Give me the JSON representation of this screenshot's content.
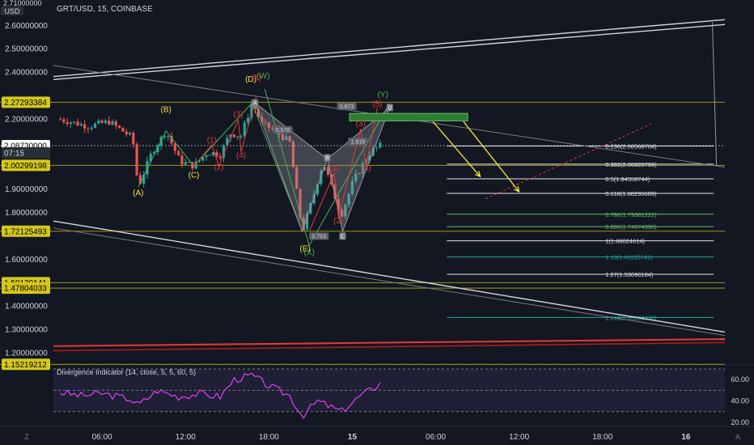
{
  "header": {
    "symbol_line": "GRT/USD, 15, COINBASE"
  },
  "price_axis": {
    "currency": "USD",
    "top_label": "2.71000000",
    "ticks": [
      "2.60000000",
      "2.50000000",
      "2.40000000",
      "2.20000000",
      "1.90000000",
      "1.80000000",
      "1.60000000",
      "1.40000000",
      "1.30000000",
      "1.20000000"
    ],
    "tick_values": [
      2.6,
      2.5,
      2.4,
      2.2,
      1.9,
      1.8,
      1.6,
      1.4,
      1.3,
      1.2
    ],
    "tags": [
      {
        "text": "2.27293384",
        "value": 2.27293384,
        "color": "#d4c81c",
        "tcolor": "#000000"
      },
      {
        "text": "2.08730000",
        "value": 2.0873,
        "color": "#ffffff",
        "tcolor": "#000000"
      },
      {
        "text": "07:15",
        "value": 2.0565,
        "color": "#2a2e39",
        "tcolor": "#d1d4dc"
      },
      {
        "text": "2.00299198",
        "value": 2.00299198,
        "color": "#d4c81c",
        "tcolor": "#000000"
      },
      {
        "text": "1.72125493",
        "value": 1.72125493,
        "color": "#d4c81c",
        "tcolor": "#000000"
      },
      {
        "text": "1.50139141",
        "value": 1.50139141,
        "color": "#d4c81c",
        "tcolor": "#000000"
      },
      {
        "text": "1.47804033",
        "value": 1.47804033,
        "color": "#d4c81c",
        "tcolor": "#000000"
      },
      {
        "text": "1.15219212",
        "value": 1.15219212,
        "color": "#d4c81c",
        "tcolor": "#000000"
      }
    ]
  },
  "time_axis": {
    "ticks": [
      "06:00",
      "12:00",
      "18:00",
      "15",
      "06:00",
      "12:00",
      "18:00",
      "16"
    ],
    "tick_hours": [
      6,
      12,
      18,
      24,
      30,
      36,
      42,
      48
    ]
  },
  "fib_levels": [
    {
      "label": "0.236(2.08568764)",
      "value": 2.08568764,
      "color": "#e0e3eb"
    },
    {
      "label": "0.382(2.00820799)",
      "value": 2.00820799,
      "color": "#e0e3eb"
    },
    {
      "label": "0.5(1.94558744)",
      "value": 1.94558744,
      "color": "#e0e3eb"
    },
    {
      "label": "0.618(1.88296689)",
      "value": 1.88296689,
      "color": "#e0e3eb"
    },
    {
      "label": "0.786(1.79381222)",
      "value": 1.79381222,
      "color": "#66bb6a"
    },
    {
      "label": "0.886(1.74074396)",
      "value": 1.74074396,
      "color": "#66bb6a"
    },
    {
      "label": "1(1.68024614)",
      "value": 1.68024614,
      "color": "#e0e3eb"
    },
    {
      "label": "1.13(1.61125741)",
      "value": 1.61125741,
      "color": "#26a69a"
    },
    {
      "label": "1.27(1.53696184)",
      "value": 1.53696184,
      "color": "#e0e3eb"
    },
    {
      "label": "1.618(1.35228430)",
      "value": 1.3522843,
      "color": "#26a69a"
    }
  ],
  "wave_labels": [
    {
      "text": "(A)",
      "color": "#f5e342",
      "t": 8.6,
      "v": 1.875
    },
    {
      "text": "(B)",
      "color": "#f5e342",
      "t": 10.6,
      "v": 2.23
    },
    {
      "text": "(C)",
      "color": "#f5e342",
      "t": 12.6,
      "v": 1.95
    },
    {
      "text": "(D)",
      "color": "#f5e342",
      "t": 16.7,
      "v": 2.36
    },
    {
      "text": "(E)",
      "color": "#f5e342",
      "t": 20.6,
      "v": 1.635
    },
    {
      "text": "(W)",
      "color": "#4caf50",
      "t": 17.6,
      "v": 2.375
    },
    {
      "text": "(X)",
      "color": "#4caf50",
      "t": 20.9,
      "v": 1.62
    },
    {
      "text": "(Y)",
      "color": "#4caf50",
      "t": 26.2,
      "v": 2.295
    },
    {
      "text": "(1)",
      "color": "#e53935",
      "t": 13.9,
      "v": 2.1
    },
    {
      "text": "(2)",
      "color": "#e53935",
      "t": 14.4,
      "v": 1.985
    },
    {
      "text": "(3)",
      "color": "#e53935",
      "t": 15.8,
      "v": 2.21
    },
    {
      "text": "(4)",
      "color": "#e53935",
      "t": 16.0,
      "v": 2.035
    },
    {
      "text": "(5)",
      "color": "#e53935",
      "t": 17.1,
      "v": 2.365
    },
    {
      "text": "(1)",
      "color": "#e53935",
      "t": 22.7,
      "v": 1.98
    },
    {
      "text": "(2)",
      "color": "#e53935",
      "t": 23.0,
      "v": 1.755
    },
    {
      "text": "(3)",
      "color": "#e53935",
      "t": 24.6,
      "v": 2.17
    },
    {
      "text": "(4)",
      "color": "#e53935",
      "t": 25.0,
      "v": 1.98
    },
    {
      "text": "(5)",
      "color": "#e53935",
      "t": 25.8,
      "v": 2.255
    }
  ],
  "pattern_labels": [
    {
      "text": "A",
      "t": 17.0,
      "v": 2.265
    },
    {
      "text": "B",
      "t": 22.2,
      "v": 2.03
    },
    {
      "text": "C",
      "t": 23.3,
      "v": 1.695
    },
    {
      "text": "D",
      "t": 26.7,
      "v": 2.245
    }
  ],
  "ratio_labels": [
    {
      "text": "0.873",
      "t": 23.6,
      "v": 2.25
    },
    {
      "text": "0.578",
      "t": 19.0,
      "v": 2.15
    },
    {
      "text": "1.918",
      "t": 24.4,
      "v": 2.1
    },
    {
      "text": "0.753",
      "t": 21.6,
      "v": 1.695
    }
  ],
  "indicator": {
    "title": "Divergence Indicator (14, close, 5, 5, 60, 5)",
    "ticks": [
      "60.00",
      "40.00",
      "20.00"
    ],
    "tick_values": [
      60,
      40,
      20
    ]
  },
  "chart_data": {
    "type": "candlestick",
    "title": "GRT/USD, 15, COINBASE",
    "xlabel": "",
    "ylabel": "USD",
    "ylim": [
      1.16,
      2.71
    ],
    "xlim_hours": [
      2.5,
      50.8
    ],
    "series": [
      {
        "name": "GRT/USD",
        "points": [
          [
            3.0,
            2.2
          ],
          [
            5.0,
            2.17
          ],
          [
            6.5,
            2.19
          ],
          [
            8.2,
            2.12
          ],
          [
            8.6,
            1.91
          ],
          [
            9.6,
            2.06
          ],
          [
            10.6,
            2.15
          ],
          [
            11.6,
            2.02
          ],
          [
            12.6,
            2.0
          ],
          [
            13.6,
            2.06
          ],
          [
            14.5,
            2.05
          ],
          [
            15.2,
            2.14
          ],
          [
            16.0,
            2.13
          ],
          [
            16.8,
            2.27
          ],
          [
            17.5,
            2.18
          ],
          [
            18.5,
            2.15
          ],
          [
            19.5,
            2.1
          ],
          [
            20.4,
            1.72
          ],
          [
            21.1,
            1.85
          ],
          [
            21.9,
            2.02
          ],
          [
            22.5,
            1.91
          ],
          [
            23.2,
            1.79
          ],
          [
            24.1,
            1.94
          ],
          [
            25.3,
            2.06
          ],
          [
            26.1,
            2.09
          ]
        ]
      }
    ],
    "oscillator": {
      "name": "Divergence Indicator",
      "ylim": [
        20,
        70
      ],
      "points": [
        [
          3.0,
          48
        ],
        [
          4.5,
          45
        ],
        [
          6.0,
          47
        ],
        [
          8.0,
          42
        ],
        [
          8.6,
          36
        ],
        [
          10.0,
          50
        ],
        [
          11.5,
          44
        ],
        [
          13.0,
          47
        ],
        [
          14.5,
          44
        ],
        [
          15.5,
          60
        ],
        [
          16.8,
          64
        ],
        [
          18.0,
          54
        ],
        [
          19.5,
          45
        ],
        [
          20.4,
          26
        ],
        [
          21.5,
          40
        ],
        [
          23.2,
          30
        ],
        [
          24.5,
          44
        ],
        [
          26.2,
          58
        ]
      ]
    }
  }
}
